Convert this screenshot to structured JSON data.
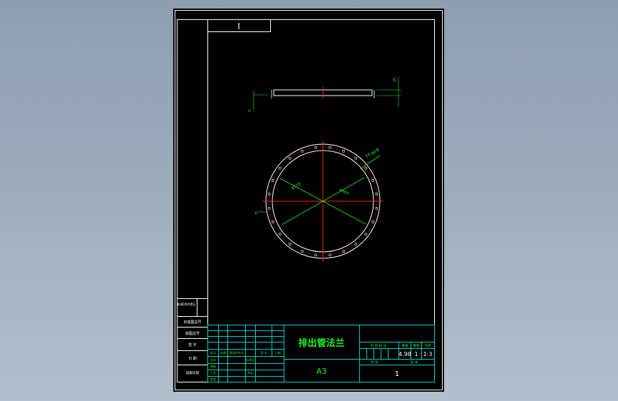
{
  "sheet": {
    "sheet_marker": "I",
    "paper_size": "A3",
    "part_title": "排出管法兰",
    "weight": "4.98",
    "count": "1",
    "scale": "1:3",
    "sheet_num": "1"
  },
  "dims": {
    "bolt_holes": "24-φ18",
    "od": "φ860",
    "pcd": "φ820",
    "id": "φ718",
    "thickness": "10",
    "edge": "5"
  },
  "side_labels": {
    "row1a": "借(通)用件登记",
    "row1b": "",
    "row2": "旧底图总号",
    "row3": "底图总号",
    "row4": "签 字",
    "row5": "日 期",
    "row6": "描图日期"
  },
  "title_block": {
    "h_mark": "标记",
    "h_count": "处数",
    "h_file": "更改文件号",
    "h_sign": "签 字",
    "h_date": "日期",
    "r_design": "设计",
    "r_check": "审核",
    "r_proc": "工艺",
    "r_std": "标准化",
    "r_approve": "批准",
    "r_review": "审定",
    "stage_label": "阶 段 标 记",
    "weight_label": "重量",
    "qty_label": "数量",
    "scale_label": "比例",
    "sheet_total_label": "共    张",
    "sheet_label": "第    张"
  },
  "colors": {
    "background": "#9aa9ba",
    "sheet": "#000000",
    "frame": "#ffffff",
    "grid": "#00cccc",
    "title_text": "#22ee22",
    "dimension": "#22ee22",
    "center_line": "#ff2020"
  }
}
